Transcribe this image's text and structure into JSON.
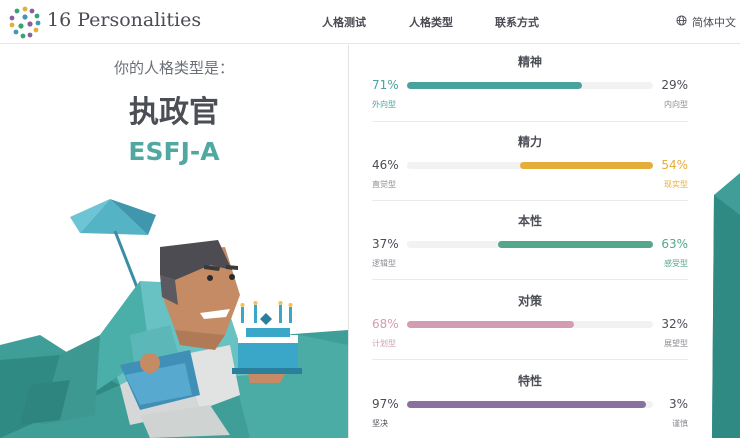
{
  "header": {
    "logo_text": "16 Personalities",
    "nav": [
      "人格测试",
      "人格类型",
      "联系方式"
    ],
    "language": "简体中文",
    "logo_icon": "dots-circle-logo-icon",
    "globe_icon": "globe-icon"
  },
  "result": {
    "intro": "你的人格类型是：",
    "type_name": "执政官",
    "type_code": "ESFJ-A"
  },
  "traits": [
    {
      "title": "精神",
      "left_pct": "71%",
      "right_pct": "29%",
      "left_label": "外向型",
      "right_label": "内向型",
      "value": 71,
      "dominant": "left",
      "color": "#4aa29f"
    },
    {
      "title": "精力",
      "left_pct": "46%",
      "right_pct": "54%",
      "left_label": "直觉型",
      "right_label": "现实型",
      "value": 54,
      "dominant": "right",
      "color": "#e4ae3a"
    },
    {
      "title": "本性",
      "left_pct": "37%",
      "right_pct": "63%",
      "left_label": "逻辑型",
      "right_label": "感受型",
      "value": 63,
      "dominant": "right",
      "color": "#54a788"
    },
    {
      "title": "对策",
      "left_pct": "68%",
      "right_pct": "32%",
      "left_label": "计划型",
      "right_label": "展望型",
      "value": 68,
      "dominant": "left",
      "color": "#d49cb2"
    },
    {
      "title": "特性",
      "left_pct": "97%",
      "right_pct": "3%",
      "left_label": "坚决",
      "right_label": "谨慎",
      "value": 97,
      "dominant": "left",
      "color": "#8a70a0"
    }
  ],
  "colors": {
    "accent": "#51a8a3",
    "teal_dark": "#3c9a93"
  }
}
